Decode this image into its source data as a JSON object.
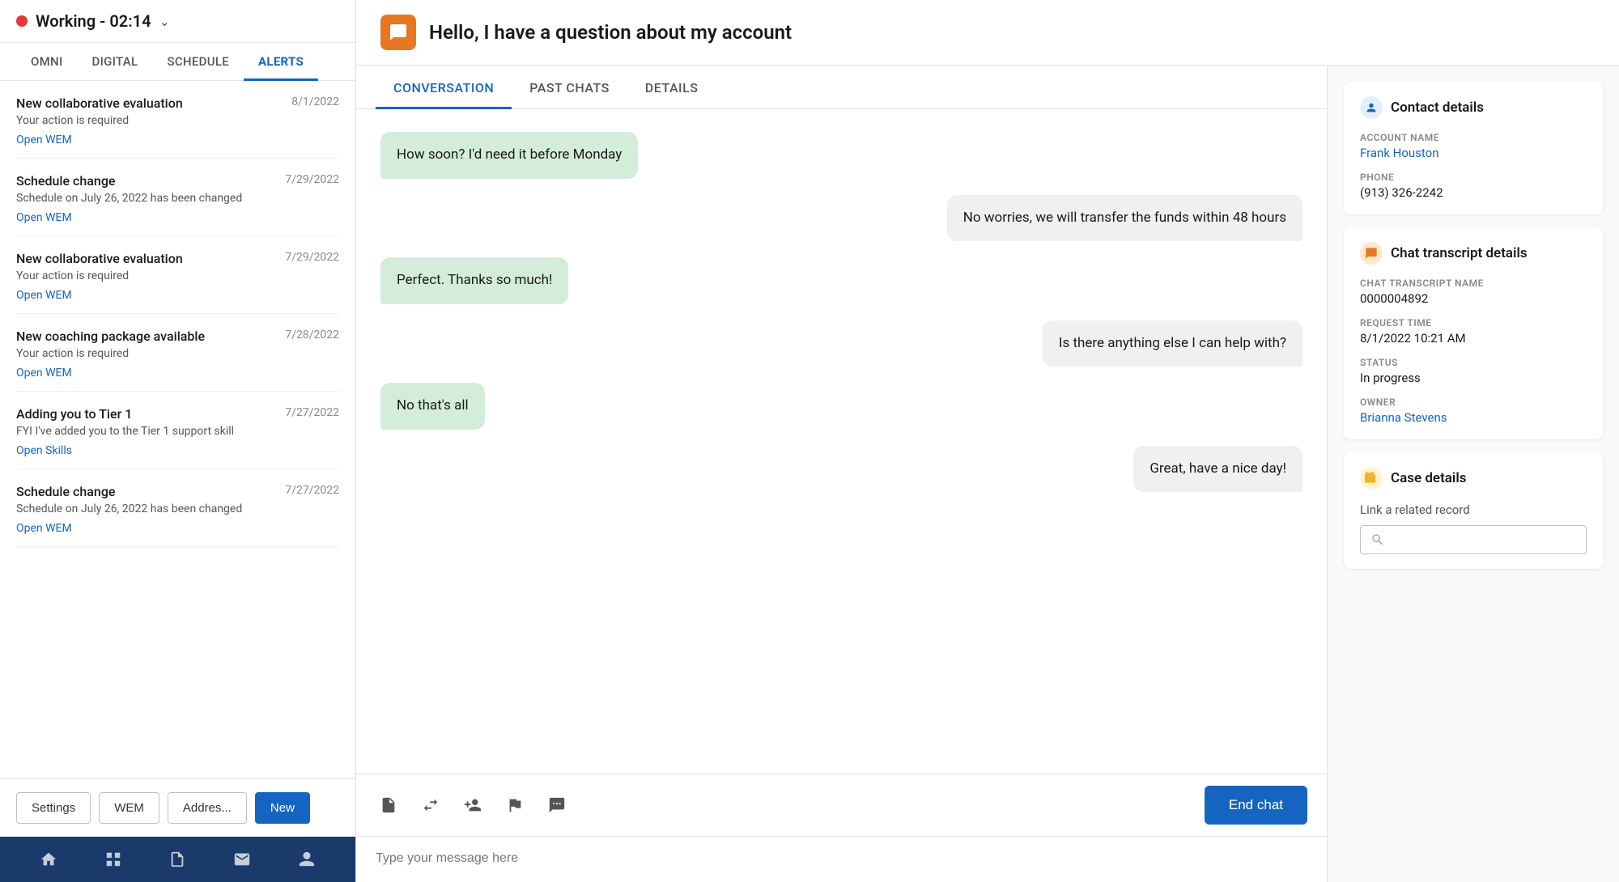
{
  "sidebar": {
    "status": "Working - 02:14",
    "nav_tabs": [
      {
        "id": "omni",
        "label": "OMNI"
      },
      {
        "id": "digital",
        "label": "DIGITAL"
      },
      {
        "id": "schedule",
        "label": "SCHEDULE"
      },
      {
        "id": "alerts",
        "label": "ALERTS",
        "active": true
      }
    ],
    "alerts": [
      {
        "title": "New collaborative evaluation",
        "date": "8/1/2022",
        "description": "Your action is required",
        "link": "Open WEM"
      },
      {
        "title": "Schedule change",
        "date": "7/29/2022",
        "description": "Schedule on July 26, 2022 has been changed",
        "link": "Open WEM"
      },
      {
        "title": "New collaborative evaluation",
        "date": "7/29/2022",
        "description": "Your action is required",
        "link": "Open WEM"
      },
      {
        "title": "New coaching package available",
        "date": "7/28/2022",
        "description": "Your action is required",
        "link": "Open WEM"
      },
      {
        "title": "Adding you to Tier 1",
        "date": "7/27/2022",
        "description": "FYI I've added you to the Tier 1 support skill",
        "link": "Open Skills"
      },
      {
        "title": "Schedule change",
        "date": "7/27/2022",
        "description": "Schedule on July 26, 2022 has been changed",
        "link": "Open WEM"
      }
    ],
    "footer_buttons": [
      {
        "label": "Settings",
        "style": "default"
      },
      {
        "label": "WEM",
        "style": "default"
      },
      {
        "label": "Addres...",
        "style": "default"
      },
      {
        "label": "New",
        "style": "primary"
      }
    ]
  },
  "chat": {
    "header_title": "Hello, I have a question about my account",
    "tabs": [
      {
        "id": "conversation",
        "label": "CONVERSATION",
        "active": true
      },
      {
        "id": "past_chats",
        "label": "PAST CHATS"
      },
      {
        "id": "details",
        "label": "DETAILS"
      }
    ],
    "messages": [
      {
        "text": "How soon? I'd need it before Monday",
        "type": "incoming"
      },
      {
        "text": "No worries, we will transfer the funds within 48 hours",
        "type": "outgoing"
      },
      {
        "text": "Perfect. Thanks so much!",
        "type": "incoming"
      },
      {
        "text": "Is there anything else I can help with?",
        "type": "outgoing"
      },
      {
        "text": "No that's all",
        "type": "incoming"
      },
      {
        "text": "Great, have a nice day!",
        "type": "outgoing"
      }
    ],
    "input_placeholder": "Type your message here",
    "end_chat_label": "End chat",
    "toolbar_icons": [
      "note",
      "transfer",
      "add-person",
      "flag",
      "chat-bubble"
    ]
  },
  "right_panel": {
    "contact_details": {
      "title": "Contact details",
      "account_name_label": "ACCOUNT NAME",
      "account_name": "Frank Houston",
      "phone_label": "PHONE",
      "phone": "(913) 326-2242"
    },
    "chat_transcript": {
      "title": "Chat transcript details",
      "transcript_name_label": "CHAT TRANSCRIPT NAME",
      "transcript_name": "0000004892",
      "request_time_label": "REQUEST TIME",
      "request_time": "8/1/2022 10:21 AM",
      "status_label": "STATUS",
      "status": "In progress",
      "owner_label": "OWNER",
      "owner": "Brianna Stevens"
    },
    "case_details": {
      "title": "Case details",
      "link_label": "Link a related record",
      "search_placeholder": ""
    }
  }
}
